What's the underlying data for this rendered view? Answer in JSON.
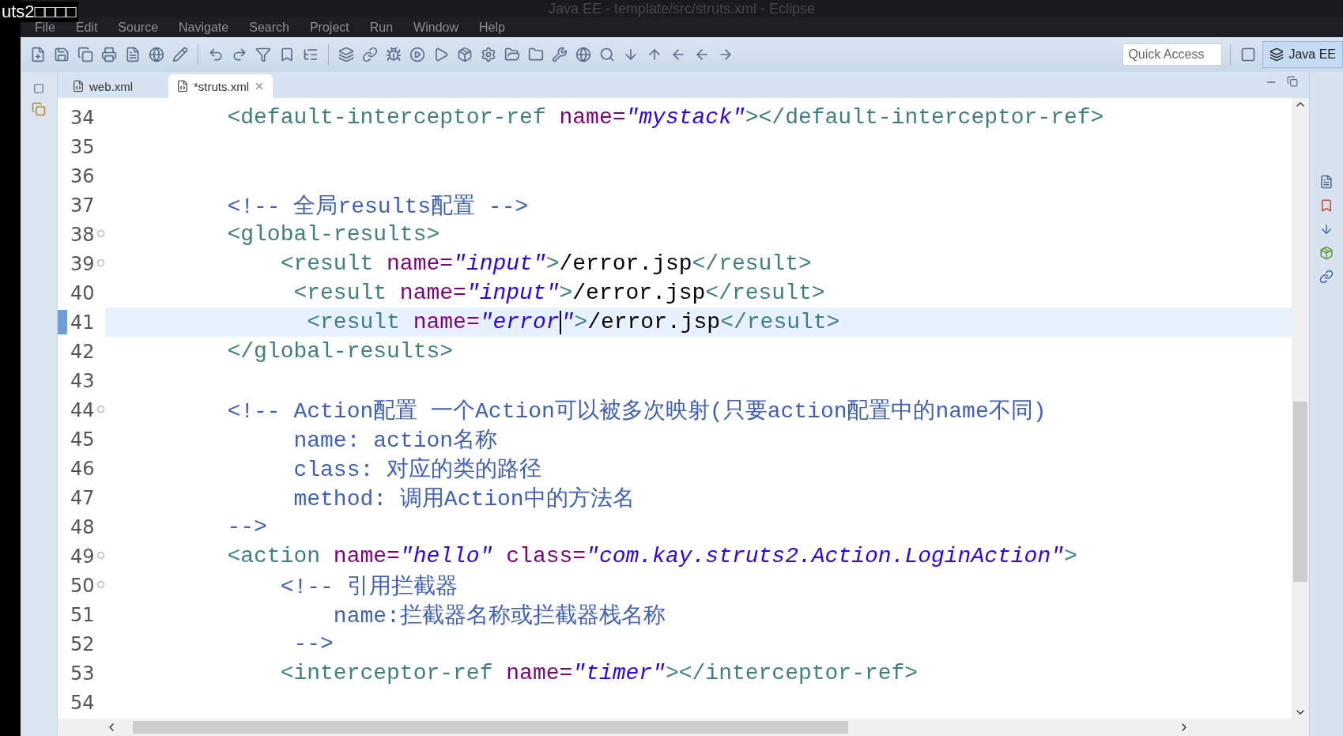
{
  "overlay_caption": "uts2□□□□",
  "window": {
    "title": "Java EE - template/src/struts.xml - Eclipse"
  },
  "menu": [
    "File",
    "Edit",
    "Source",
    "Navigate",
    "Search",
    "Project",
    "Run",
    "Window",
    "Help"
  ],
  "quick_access": {
    "placeholder": "Quick Access"
  },
  "perspective": {
    "label": "Java EE",
    "selected": true
  },
  "tabs": [
    {
      "label": "web.xml",
      "selected": false,
      "closable": false
    },
    {
      "label": "*struts.xml",
      "selected": true,
      "closable": true
    }
  ],
  "editor": {
    "lines": [
      {
        "number": "34",
        "folding": false,
        "current": false,
        "segments": [
          {
            "kind": "tag",
            "text": "        <default-interceptor-ref "
          },
          {
            "kind": "attr",
            "text": "name="
          },
          {
            "kind": "value",
            "text": "\"mystack\""
          },
          {
            "kind": "tag",
            "text": "></default-interceptor-ref>"
          }
        ]
      },
      {
        "number": "35",
        "folding": false,
        "current": false
      },
      {
        "number": "36",
        "folding": false,
        "current": false
      },
      {
        "number": "37",
        "folding": false,
        "current": false,
        "segments": [
          {
            "kind": "comment",
            "text": "        <!-- 全局results配置 -->"
          }
        ]
      },
      {
        "number": "38",
        "folding": true,
        "current": false,
        "segments": [
          {
            "kind": "tag",
            "text": "        <global-results>"
          }
        ]
      },
      {
        "number": "39",
        "folding": true,
        "current": false,
        "segments": [
          {
            "kind": "tag",
            "text": "            <result "
          },
          {
            "kind": "attr",
            "text": "name="
          },
          {
            "kind": "value",
            "text": "\"input\""
          },
          {
            "kind": "tag",
            "text": ">"
          },
          {
            "kind": "text",
            "text": "/error.jsp"
          },
          {
            "kind": "tag",
            "text": "</result>"
          }
        ]
      },
      {
        "number": "40",
        "folding": false,
        "current": false,
        "segments": [
          {
            "kind": "tag",
            "text": "             <result "
          },
          {
            "kind": "attr",
            "text": "name="
          },
          {
            "kind": "value",
            "text": "\"input\""
          },
          {
            "kind": "tag",
            "text": ">"
          },
          {
            "kind": "text",
            "text": "/error.jsp"
          },
          {
            "kind": "tag",
            "text": "</result>"
          }
        ]
      },
      {
        "number": "41",
        "folding": false,
        "current": true,
        "segments": [
          {
            "kind": "tag",
            "text": "              <result "
          },
          {
            "kind": "attr",
            "text": "name="
          },
          {
            "kind": "value",
            "text": "\"error"
          },
          {
            "kind": "caret"
          },
          {
            "kind": "value",
            "text": "\""
          },
          {
            "kind": "tag",
            "text": ">"
          },
          {
            "kind": "text",
            "text": "/error.jsp"
          },
          {
            "kind": "tag",
            "text": "</result>"
          }
        ]
      },
      {
        "number": "42",
        "folding": false,
        "current": false,
        "segments": [
          {
            "kind": "tag",
            "text": "        </global-results>"
          }
        ]
      },
      {
        "number": "43",
        "folding": false,
        "current": false
      },
      {
        "number": "44",
        "folding": true,
        "current": false,
        "segments": [
          {
            "kind": "comment",
            "text": "        <!-- Action配置 一个Action可以被多次映射(只要action配置中的name不同)"
          }
        ]
      },
      {
        "number": "45",
        "folding": false,
        "current": false,
        "segments": [
          {
            "kind": "comment",
            "text": "             name: action名称"
          }
        ]
      },
      {
        "number": "46",
        "folding": false,
        "current": false,
        "segments": [
          {
            "kind": "comment",
            "text": "             class: 对应的类的路径"
          }
        ]
      },
      {
        "number": "47",
        "folding": false,
        "current": false,
        "segments": [
          {
            "kind": "comment",
            "text": "             method: 调用Action中的方法名"
          }
        ]
      },
      {
        "number": "48",
        "folding": false,
        "current": false,
        "segments": [
          {
            "kind": "comment",
            "text": "        -->"
          }
        ]
      },
      {
        "number": "49",
        "folding": true,
        "current": false,
        "segments": [
          {
            "kind": "tag",
            "text": "        <action "
          },
          {
            "kind": "attr",
            "text": "name="
          },
          {
            "kind": "value",
            "text": "\"hello\""
          },
          {
            "kind": "attr",
            "text": " class="
          },
          {
            "kind": "value",
            "text": "\"com.kay.struts2.Action.LoginAction\""
          },
          {
            "kind": "tag",
            "text": ">"
          }
        ]
      },
      {
        "number": "50",
        "folding": true,
        "current": false,
        "segments": [
          {
            "kind": "comment",
            "text": "            <!-- 引用拦截器"
          }
        ]
      },
      {
        "number": "51",
        "folding": false,
        "current": false,
        "segments": [
          {
            "kind": "comment",
            "text": "                name:拦截器名称或拦截器栈名称"
          }
        ]
      },
      {
        "number": "52",
        "folding": false,
        "current": false,
        "segments": [
          {
            "kind": "comment",
            "text": "             -->"
          }
        ]
      },
      {
        "number": "53",
        "folding": false,
        "current": false,
        "segments": [
          {
            "kind": "tag",
            "text": "            <interceptor-ref "
          },
          {
            "kind": "attr",
            "text": "name="
          },
          {
            "kind": "value",
            "text": "\"timer\""
          },
          {
            "kind": "tag",
            "text": "></interceptor-ref>"
          }
        ]
      },
      {
        "number": "54",
        "folding": false,
        "current": false
      }
    ]
  }
}
